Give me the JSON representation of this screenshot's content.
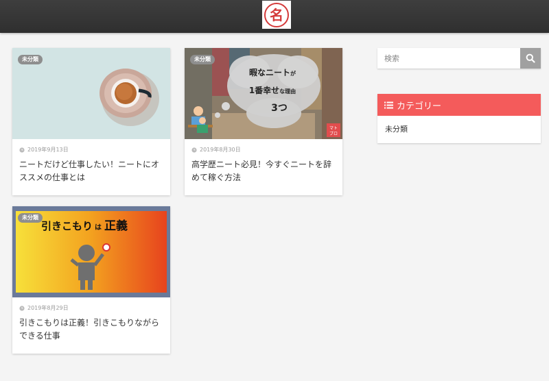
{
  "header": {
    "logo_text": "名"
  },
  "posts": [
    {
      "category": "未分類",
      "date": "2019年9月13日",
      "title": "ニートだけど仕事したい！ニートにオススメの仕事とは"
    },
    {
      "category": "未分類",
      "date": "2019年8月30日",
      "title": "高学歴ニート必見！今すぐニートを辞めて稼ぐ方法",
      "thumb_text": {
        "line1": "暇なニート",
        "line1_small": "が",
        "line2": "1番幸せ",
        "line2_small": "な理由",
        "line3": "3つ",
        "tag": "マト\nブロ"
      }
    },
    {
      "category": "未分類",
      "date": "2019年8月29日",
      "title": "引きこもりは正義！引きこもりながらできる仕事",
      "thumb_text": {
        "word1": "引きこもり",
        "small": "は",
        "word2": "正義"
      }
    }
  ],
  "sidebar": {
    "search_placeholder": "検索",
    "category_widget": {
      "title": "カテゴリー",
      "items": [
        "未分類"
      ]
    }
  },
  "colors": {
    "header": "#333333",
    "widget_accent": "#f45b5b",
    "badge": "#8e8e8e"
  }
}
